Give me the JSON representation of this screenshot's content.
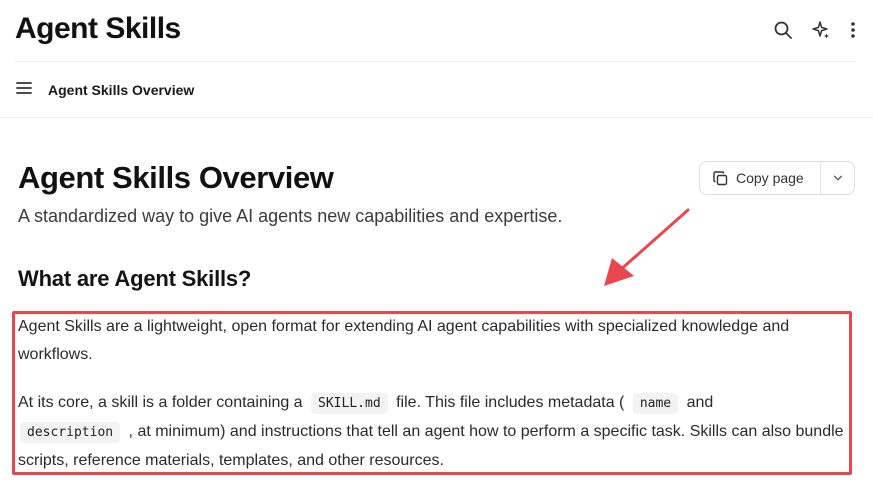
{
  "header": {
    "site_title": "Agent Skills"
  },
  "breadcrumb": {
    "current": "Agent Skills Overview"
  },
  "main": {
    "title": "Agent Skills Overview",
    "subtitle": "A standardized way to give AI agents new capabilities and expertise.",
    "copy_button_label": "Copy page",
    "section_heading": "What are Agent Skills?",
    "paragraph1": "Agent Skills are a lightweight, open format for extending AI agent capabilities with specialized knowledge and workflows.",
    "paragraph2": {
      "part1": "At its core, a skill is a folder containing a",
      "code1": "SKILL.md",
      "part2": "file. This file includes metadata (",
      "code2": "name",
      "part3": "and",
      "code3": "description",
      "part4": ", at minimum) and instructions that tell an agent how to perform a specific task. Skills can also bundle scripts, reference materials, templates, and other resources."
    }
  },
  "icons": {
    "search": "search-icon",
    "sparkle": "sparkle-icon",
    "more": "more-vertical-icon",
    "menu": "hamburger-menu-icon",
    "copy": "copy-icon",
    "chevron": "chevron-down-icon"
  },
  "colors": {
    "annotation": "#e8474d",
    "text": "#1f1f1f",
    "border": "#dcdcdc"
  }
}
